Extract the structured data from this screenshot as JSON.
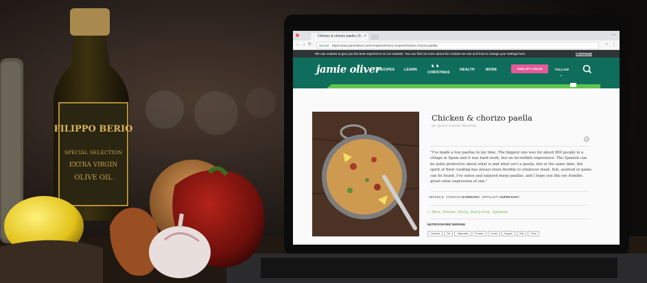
{
  "browser": {
    "tab_title": "Chicken & chorizo paella | R...",
    "tab_close": "×",
    "secure_label": "Secure",
    "url": "https://www.jamieoliver.com/recipes/chicken-recipes/chicken-chorizo-paella/"
  },
  "cookie_banner": {
    "text": "We use cookies to give you the best experience on our website. You can find out more about the cookies we use and how to change your settings here.",
    "continue_label": "CONTINUE"
  },
  "site_nav": {
    "logo": "jamie oliver",
    "items": [
      "RECIPES",
      "LEARN",
      "CHRISTMAS",
      "HEALTH",
      "MORE"
    ],
    "signup_label": "SIGN UP / LOG IN",
    "follow_label": "FOLLOW"
  },
  "recipe": {
    "title": "Chicken & chorizo paella",
    "subtitle": "MY QUICK & EASY RECIPES",
    "quote": "\"I've made a few paellas in my time. The biggest one was for about 800 people in a village in Spain and it was hard work, but an incredible experience. The Spanish can be quite protective about what is and what isn't a paella, but at the same time, the spirit of their cooking has always been flexible to whatever meat, fish, seafood or game can be found. I've eaten and enjoyed many paellas, and I hope you like my humble, great-value expression of one.\"",
    "serves_label": "SERVES",
    "serves_value": "4",
    "cooks_label": "COOKS IN",
    "cooks_value": "40 MINUTES",
    "difficulty_label": "DIFFICULTY",
    "difficulty_value": "SUPER EASY",
    "tags": "Rice, Dinner, Party, Dairy-free, Spanish",
    "nutrition_label": "NUTRITION PER SERVING",
    "nutrition_items": [
      "Calories",
      "Fat",
      "Saturates",
      "Protein",
      "Carbs",
      "Sugars",
      "Salt",
      "Fibre"
    ]
  },
  "bottle_label": {
    "brand": "FILIPPO BERIO",
    "line1": "SPECIAL SELECTION",
    "line2": "EXTRA VIRGIN",
    "line3": "OLIVE OIL"
  },
  "colors": {
    "site_green": "#0f6e5b",
    "accent_green": "#5fc44e",
    "signup_pink": "#e55a99"
  }
}
